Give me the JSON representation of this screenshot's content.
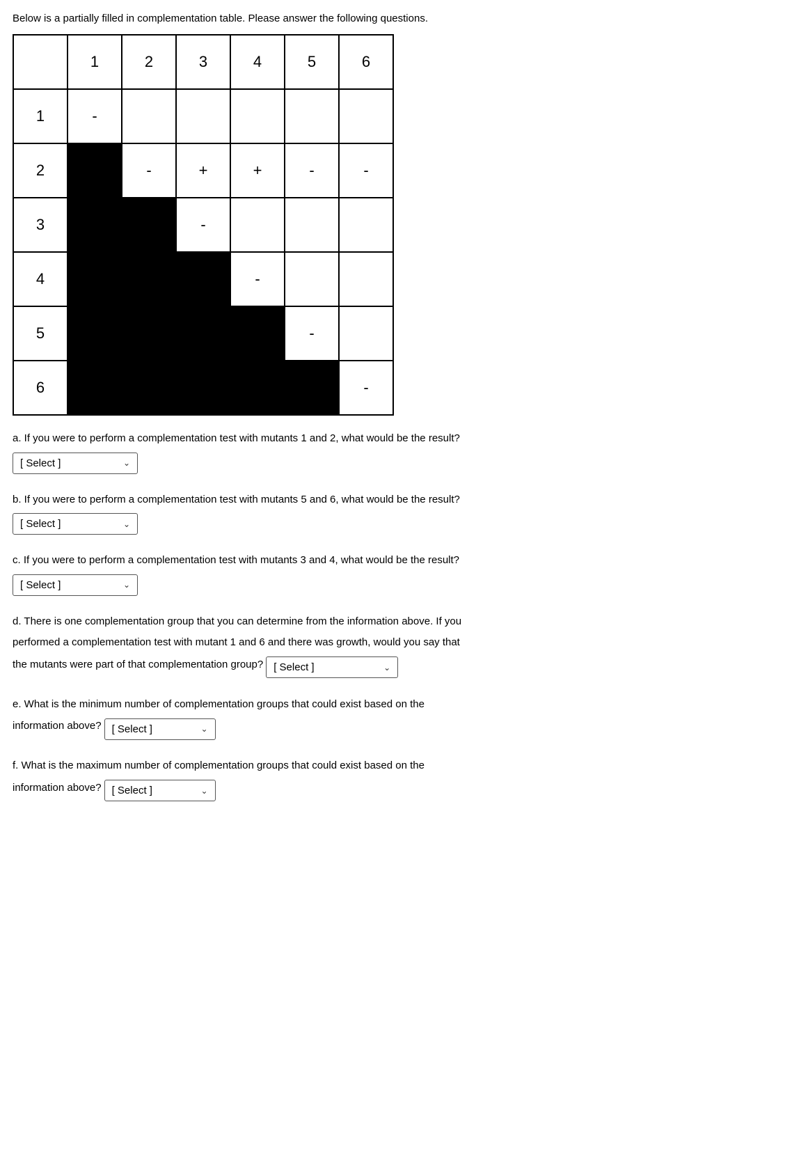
{
  "intro": "Below is a partially filled in complementation table. Please answer the following questions.",
  "table": {
    "col_headers": [
      "",
      "1",
      "2",
      "3",
      "4",
      "5",
      "6"
    ],
    "rows": [
      {
        "row_header": "1",
        "cells": [
          "dash",
          "empty",
          "empty",
          "empty",
          "empty",
          "empty"
        ]
      },
      {
        "row_header": "2",
        "cells": [
          "black",
          "dash",
          "plus",
          "plus",
          "dash",
          "dash"
        ]
      },
      {
        "row_header": "3",
        "cells": [
          "black",
          "black",
          "dash",
          "empty",
          "empty",
          "empty"
        ]
      },
      {
        "row_header": "4",
        "cells": [
          "black",
          "black",
          "black",
          "dash",
          "empty",
          "empty"
        ]
      },
      {
        "row_header": "5",
        "cells": [
          "black",
          "black",
          "black",
          "black",
          "dash",
          "empty"
        ]
      },
      {
        "row_header": "6",
        "cells": [
          "black",
          "black",
          "black",
          "black",
          "black",
          "dash"
        ]
      }
    ]
  },
  "questions": {
    "a": {
      "text": "a. If you were to perform a complementation test with mutants 1 and 2, what would be the result?",
      "select_label": "[ Select ]"
    },
    "b": {
      "text": "b. If you were to perform a complementation test with mutants 5 and 6, what would be the result?",
      "select_label": "[ Select ]"
    },
    "c": {
      "text": "c. If you were to perform a complementation test with mutants 3 and 4, what would be the result?",
      "select_label": "[ Select ]"
    },
    "d": {
      "line1": "d. There is one complementation group that you can determine from the information above. If you",
      "line2": "performed a complementation test with mutant 1 and 6 and there was growth, would you say that",
      "line3": "the mutants were part of that complementation group?",
      "select_label": "[ Select ]"
    },
    "e": {
      "line1": "e. What is the minimum number of complementation groups that could exist based on the",
      "line2": "information above?",
      "select_label": "[ Select ]"
    },
    "f": {
      "line1": "f. What is the maximum number of complementation groups that could exist based on the",
      "line2": "information above?",
      "select_label": "[ Select ]"
    }
  }
}
